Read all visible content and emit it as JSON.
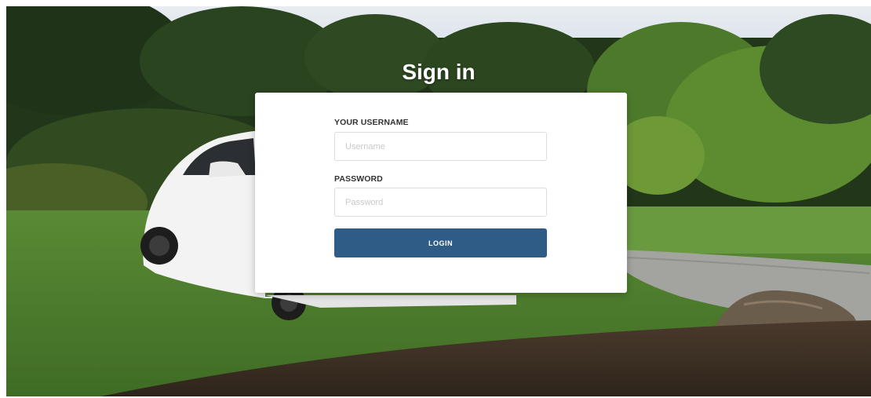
{
  "page": {
    "title": "Sign in"
  },
  "form": {
    "username_label": "YOUR USERNAME",
    "username_placeholder": "Username",
    "password_label": "PASSWORD",
    "password_placeholder": "Password",
    "login_label": "LOGIN"
  },
  "colors": {
    "button": "#2f5b87",
    "card": "#ffffff",
    "title": "#ffffff"
  }
}
